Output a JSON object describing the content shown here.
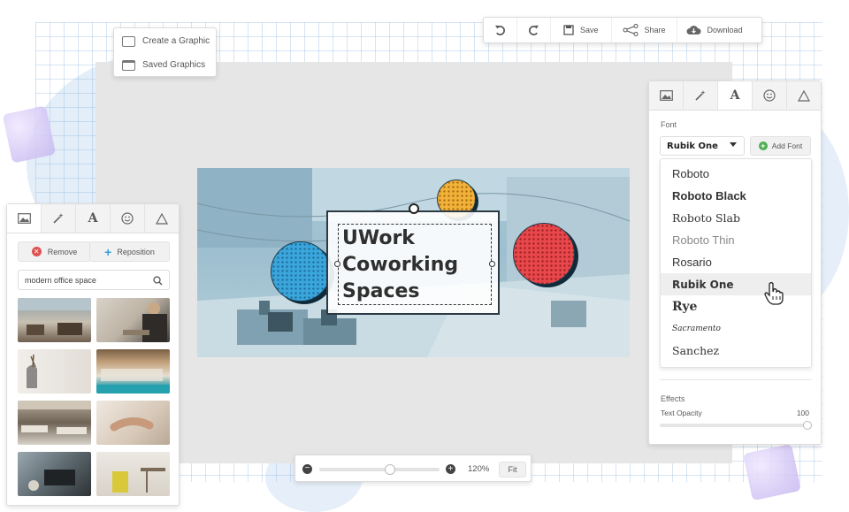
{
  "top_menu": {
    "items": [
      {
        "label": "Create a Graphic",
        "icon": "image-icon"
      },
      {
        "label": "Saved Graphics",
        "icon": "folder-icon"
      }
    ]
  },
  "toolbar": {
    "save": "Save",
    "share": "Share",
    "download": "Download"
  },
  "left_panel": {
    "tabs": [
      "image",
      "magic-wand",
      "A",
      "smiley",
      "triangle"
    ],
    "remove_label": "Remove",
    "reposition_label": "Reposition",
    "search_value": "modern office space"
  },
  "canvas": {
    "line1": "UWork",
    "line2": "Coworking",
    "line3": "Spaces"
  },
  "right_panel": {
    "tabs": [
      "image",
      "magic-wand",
      "A",
      "smiley",
      "triangle"
    ],
    "font_label": "Font",
    "font_selected": "Rubik One",
    "add_font_label": "Add Font",
    "fonts": [
      "Roboto",
      "Roboto Black",
      "Roboto Slab",
      "Roboto Thin",
      "Rosario",
      "Rubik One",
      "Rye",
      "Sacramento",
      "Sanchez"
    ],
    "effects_label": "Effects",
    "opacity_label": "Text Opacity",
    "opacity_value": "100"
  },
  "zoom": {
    "level": "120%",
    "fit_label": "Fit"
  },
  "colors": {
    "blue": "#3aa6dc",
    "yellow": "#f2b23a",
    "red": "#e8484c",
    "accent_green": "#4caf50",
    "remove_red": "#e05050",
    "reposition_blue": "#3aa0d8"
  }
}
